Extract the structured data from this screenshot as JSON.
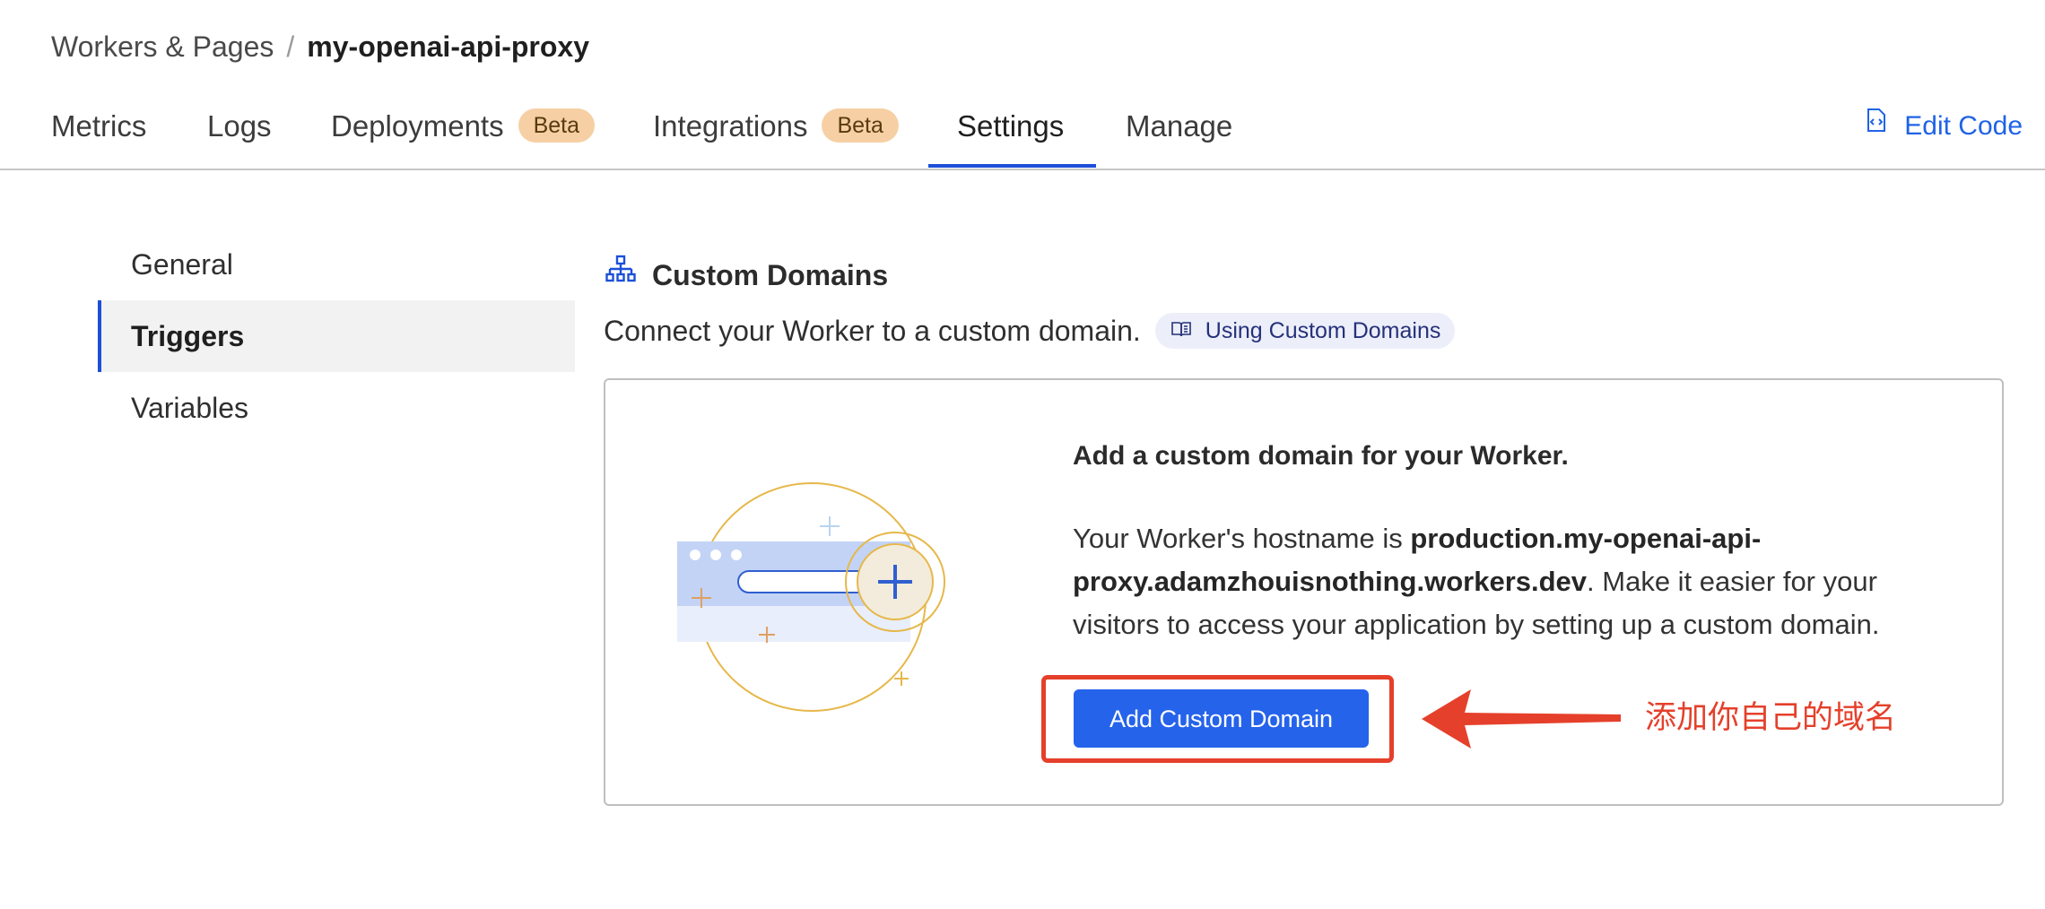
{
  "breadcrumb": {
    "parent": "Workers & Pages",
    "separator": "/",
    "current": "my-openai-api-proxy"
  },
  "tabs": [
    {
      "label": "Metrics",
      "active": false
    },
    {
      "label": "Logs",
      "active": false
    },
    {
      "label": "Deployments",
      "badge": "Beta",
      "active": false
    },
    {
      "label": "Integrations",
      "badge": "Beta",
      "active": false
    },
    {
      "label": "Settings",
      "active": true
    },
    {
      "label": "Manage",
      "active": false
    }
  ],
  "edit_code": {
    "label": "Edit Code",
    "icon": "code-file-icon"
  },
  "sidebar": {
    "items": [
      {
        "label": "General",
        "active": false
      },
      {
        "label": "Triggers",
        "active": true
      },
      {
        "label": "Variables",
        "active": false
      }
    ]
  },
  "section": {
    "icon": "sitemap-icon",
    "title": "Custom Domains",
    "description": "Connect your Worker to a custom domain.",
    "doc_link": {
      "icon": "book-icon",
      "label": "Using Custom Domains"
    }
  },
  "card": {
    "illustration_icon": "browser-add-domain-illustration",
    "heading": "Add a custom domain for your Worker.",
    "body_prefix": "Your Worker's hostname is ",
    "hostname": "production.my-openai-api-proxy.adamzhouisnothing.workers.dev",
    "body_suffix": ". Make it easier for your visitors to access your application by setting up a custom domain.",
    "button_label": "Add Custom Domain"
  },
  "annotation": {
    "text": "添加你自己的域名",
    "color": "#e5402b"
  },
  "colors": {
    "accent": "#1d4fd8",
    "link": "#1f63e6",
    "button": "#2563eb",
    "badge_bg": "#f6d0a4",
    "annotation": "#e5402b"
  }
}
